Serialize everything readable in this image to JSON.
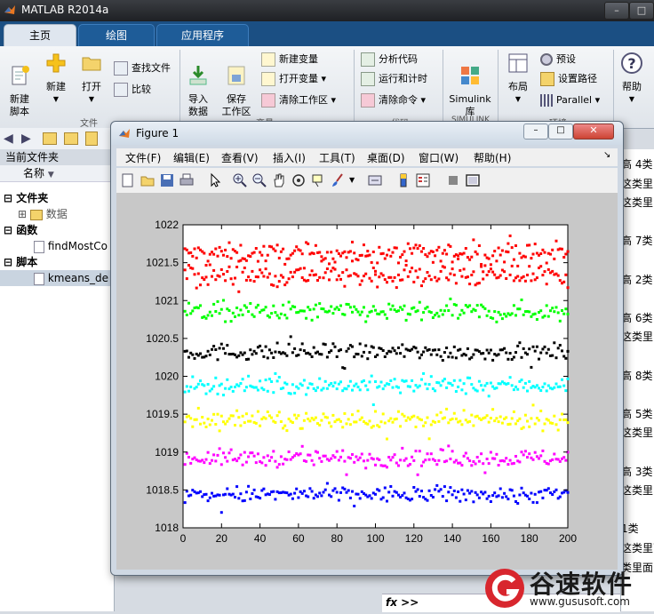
{
  "window": {
    "title": "MATLAB R2014a"
  },
  "tabs": [
    {
      "label": "主页",
      "active": true
    },
    {
      "label": "绘图",
      "active": false
    },
    {
      "label": "应用程序",
      "active": false
    }
  ],
  "ribbon": {
    "new_script": "新建\n脚本",
    "new": "新建",
    "open": "打开",
    "find_files": "查找文件",
    "compare": "比较",
    "file_group": "文件",
    "import": "导入\n数据",
    "save_ws": "保存\n工作区",
    "new_var": "新建变量",
    "open_var": "打开变量",
    "clear_ws": "清除工作区",
    "var_group": "变量",
    "analyze": "分析代码",
    "run_time": "运行和计时",
    "clear_cmd": "清除命令",
    "code_group": "代码",
    "simulink": "Simulink\n库",
    "simulink_group": "SIMULINK",
    "layout": "布局",
    "prefs": "预设",
    "set_path": "设置路径",
    "parallel": "Parallel",
    "env_group": "环境",
    "help": "帮助"
  },
  "current_folder": {
    "header": "当前文件夹",
    "name_col": "名称",
    "sections": [
      {
        "label": "文件夹",
        "items": [
          "数据"
        ]
      },
      {
        "label": "函数",
        "items": [
          "findMostCo"
        ]
      },
      {
        "label": "脚本",
        "items": [
          "kmeans_de"
        ]
      }
    ]
  },
  "command_window": {
    "lines": [
      "高 4类",
      "这类里",
      "这类里",
      "",
      "高 7类",
      "",
      "高 2类",
      "",
      "高 6类",
      "这类里",
      "",
      "高 8类",
      "",
      "高 5类",
      "这类里",
      "",
      "高 3类",
      "这类里",
      "",
      "1类",
      "这类里面",
      "类里面"
    ],
    "prompt": "fx >>"
  },
  "figure": {
    "title": "Figure 1",
    "menu": [
      "文件(F)",
      "编辑(E)",
      "查看(V)",
      "插入(I)",
      "工具(T)",
      "桌面(D)",
      "窗口(W)",
      "帮助(H)"
    ]
  },
  "chart_data": {
    "type": "scatter",
    "title": "",
    "xlabel": "",
    "ylabel": "",
    "xlim": [
      0,
      200
    ],
    "ylim": [
      1018,
      1022
    ],
    "xticks": [
      0,
      20,
      40,
      60,
      80,
      100,
      120,
      140,
      160,
      180,
      200
    ],
    "yticks": [
      1018,
      1018.5,
      1019,
      1019.5,
      1020,
      1020.5,
      1021,
      1021.5,
      1022
    ],
    "grid": false,
    "series": [
      {
        "color": "#ff0000",
        "center": 1021.62,
        "spread": 0.07,
        "n": 200
      },
      {
        "color": "#ff0000",
        "center": 1021.33,
        "spread": 0.08,
        "n": 200
      },
      {
        "color": "#00ff00",
        "center": 1020.85,
        "spread": 0.07,
        "n": 200
      },
      {
        "color": "#000000",
        "center": 1020.32,
        "spread": 0.06,
        "n": 200
      },
      {
        "color": "#00ffff",
        "center": 1019.88,
        "spread": 0.06,
        "n": 200
      },
      {
        "color": "#ffff00",
        "center": 1019.42,
        "spread": 0.06,
        "n": 200
      },
      {
        "color": "#ff00ff",
        "center": 1018.92,
        "spread": 0.06,
        "n": 200
      },
      {
        "color": "#0000ff",
        "center": 1018.44,
        "spread": 0.06,
        "n": 200
      }
    ]
  },
  "watermark": {
    "brand": "谷速软件",
    "url": "www.gususoft.com"
  }
}
